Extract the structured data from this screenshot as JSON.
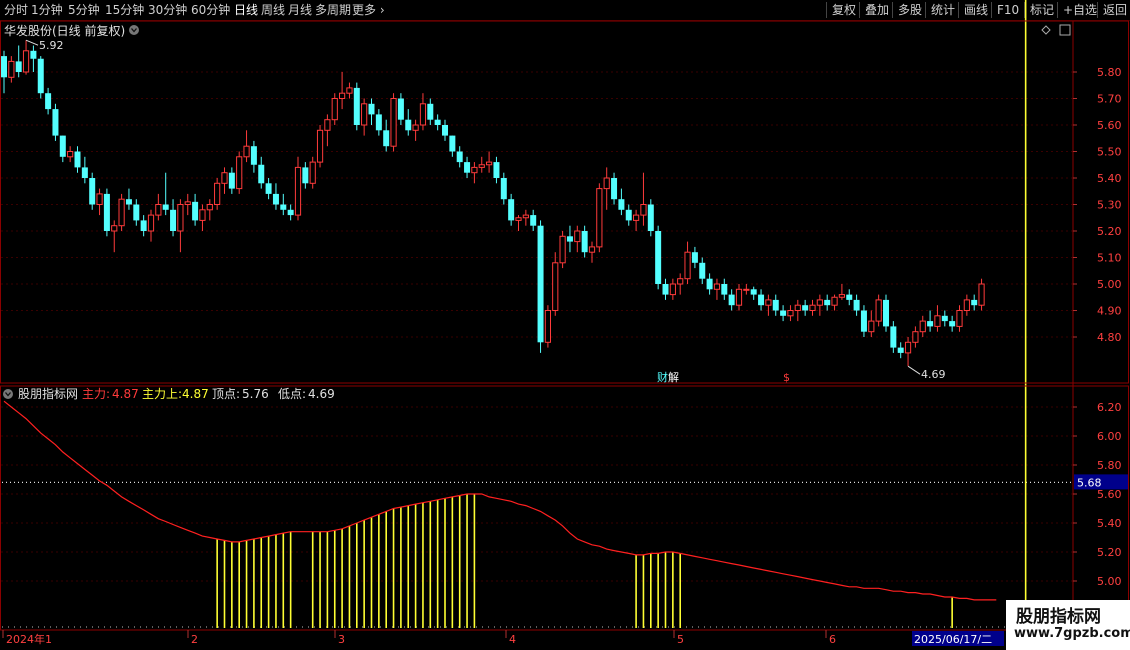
{
  "toolbar": {
    "left": [
      "分时",
      "1分钟",
      "5分钟",
      "15分钟",
      "30分钟",
      "60分钟",
      "日线",
      "周线",
      "月线",
      "多周期",
      "更多"
    ],
    "active": "日线",
    "right": [
      "复权",
      "叠加",
      "多股",
      "统计",
      "画线",
      "F10",
      "标记",
      "+自选",
      "返回"
    ]
  },
  "main_panel": {
    "title": "华发股份(日线 前复权)",
    "high_label": "5.92",
    "low_label": "4.69",
    "event_labels": [
      "财",
      "解",
      "$"
    ]
  },
  "indicator_panel": {
    "name": "股朋指标网",
    "params": [
      {
        "label": "主力:",
        "value": "4.87",
        "color": "#ff3b3b"
      },
      {
        "label": "主力上:",
        "value": "4.87",
        "color": "#ffff33"
      },
      {
        "label": "顶点:",
        "value": "5.76",
        "color": "#e0e0e0"
      },
      {
        "label": "低点:",
        "value": "4.69",
        "color": "#e0e0e0"
      }
    ],
    "dotted_value": "5.68"
  },
  "time_axis": {
    "labels": [
      "2024年1",
      "2",
      "3",
      "4",
      "5",
      "6"
    ],
    "current_date": "2025/06/17/二"
  },
  "watermark": {
    "line1": "股朋指标网",
    "line2": "www.7gpzb.com"
  },
  "chart_data": [
    {
      "type": "candlestick",
      "title": "华发股份(日线 前复权)",
      "ylim": [
        4.69,
        5.92
      ],
      "yticks": [
        4.8,
        4.9,
        5.0,
        5.1,
        5.2,
        5.3,
        5.4,
        5.5,
        5.6,
        5.7,
        5.8
      ],
      "up_color": "#ff3b3b",
      "down_color": "#54ffff",
      "ohlc": [
        [
          5.86,
          5.88,
          5.72,
          5.78
        ],
        [
          5.78,
          5.86,
          5.76,
          5.84
        ],
        [
          5.84,
          5.9,
          5.78,
          5.8
        ],
        [
          5.8,
          5.92,
          5.79,
          5.88
        ],
        [
          5.88,
          5.9,
          5.8,
          5.85
        ],
        [
          5.85,
          5.86,
          5.7,
          5.72
        ],
        [
          5.72,
          5.74,
          5.64,
          5.66
        ],
        [
          5.66,
          5.68,
          5.54,
          5.56
        ],
        [
          5.56,
          5.56,
          5.46,
          5.48
        ],
        [
          5.48,
          5.52,
          5.46,
          5.5
        ],
        [
          5.5,
          5.52,
          5.42,
          5.44
        ],
        [
          5.44,
          5.48,
          5.38,
          5.4
        ],
        [
          5.4,
          5.42,
          5.28,
          5.3
        ],
        [
          5.3,
          5.36,
          5.26,
          5.34
        ],
        [
          5.34,
          5.36,
          5.18,
          5.2
        ],
        [
          5.2,
          5.24,
          5.12,
          5.22
        ],
        [
          5.22,
          5.34,
          5.2,
          5.32
        ],
        [
          5.32,
          5.36,
          5.28,
          5.3
        ],
        [
          5.3,
          5.32,
          5.22,
          5.24
        ],
        [
          5.24,
          5.26,
          5.18,
          5.2
        ],
        [
          5.2,
          5.28,
          5.16,
          5.26
        ],
        [
          5.26,
          5.34,
          5.24,
          5.3
        ],
        [
          5.3,
          5.42,
          5.26,
          5.28
        ],
        [
          5.28,
          5.32,
          5.18,
          5.2
        ],
        [
          5.2,
          5.32,
          5.12,
          5.3
        ],
        [
          5.3,
          5.34,
          5.26,
          5.31
        ],
        [
          5.31,
          5.34,
          5.22,
          5.24
        ],
        [
          5.24,
          5.3,
          5.2,
          5.28
        ],
        [
          5.28,
          5.32,
          5.24,
          5.3
        ],
        [
          5.3,
          5.4,
          5.28,
          5.38
        ],
        [
          5.38,
          5.44,
          5.34,
          5.42
        ],
        [
          5.42,
          5.44,
          5.34,
          5.36
        ],
        [
          5.36,
          5.5,
          5.34,
          5.48
        ],
        [
          5.48,
          5.58,
          5.46,
          5.52
        ],
        [
          5.52,
          5.54,
          5.42,
          5.45
        ],
        [
          5.45,
          5.48,
          5.36,
          5.38
        ],
        [
          5.38,
          5.4,
          5.32,
          5.34
        ],
        [
          5.34,
          5.38,
          5.28,
          5.3
        ],
        [
          5.3,
          5.34,
          5.26,
          5.28
        ],
        [
          5.28,
          5.3,
          5.24,
          5.26
        ],
        [
          5.26,
          5.48,
          5.24,
          5.44
        ],
        [
          5.44,
          5.46,
          5.36,
          5.38
        ],
        [
          5.38,
          5.48,
          5.36,
          5.46
        ],
        [
          5.46,
          5.6,
          5.44,
          5.58
        ],
        [
          5.58,
          5.64,
          5.52,
          5.62
        ],
        [
          5.62,
          5.72,
          5.6,
          5.7
        ],
        [
          5.7,
          5.8,
          5.66,
          5.72
        ],
        [
          5.72,
          5.76,
          5.7,
          5.74
        ],
        [
          5.74,
          5.76,
          5.58,
          5.6
        ],
        [
          5.6,
          5.7,
          5.56,
          5.68
        ],
        [
          5.68,
          5.7,
          5.6,
          5.64
        ],
        [
          5.64,
          5.66,
          5.56,
          5.58
        ],
        [
          5.58,
          5.62,
          5.5,
          5.52
        ],
        [
          5.52,
          5.72,
          5.5,
          5.7
        ],
        [
          5.7,
          5.72,
          5.6,
          5.62
        ],
        [
          5.62,
          5.66,
          5.56,
          5.58
        ],
        [
          5.58,
          5.62,
          5.54,
          5.6
        ],
        [
          5.6,
          5.72,
          5.58,
          5.68
        ],
        [
          5.68,
          5.7,
          5.6,
          5.62
        ],
        [
          5.62,
          5.64,
          5.58,
          5.6
        ],
        [
          5.6,
          5.62,
          5.54,
          5.56
        ],
        [
          5.56,
          5.56,
          5.48,
          5.5
        ],
        [
          5.5,
          5.52,
          5.44,
          5.46
        ],
        [
          5.46,
          5.48,
          5.4,
          5.42
        ],
        [
          5.42,
          5.46,
          5.38,
          5.44
        ],
        [
          5.44,
          5.48,
          5.42,
          5.45
        ],
        [
          5.45,
          5.5,
          5.42,
          5.46
        ],
        [
          5.46,
          5.48,
          5.38,
          5.4
        ],
        [
          5.4,
          5.42,
          5.3,
          5.32
        ],
        [
          5.32,
          5.34,
          5.22,
          5.24
        ],
        [
          5.24,
          5.26,
          5.2,
          5.25
        ],
        [
          5.25,
          5.28,
          5.22,
          5.26
        ],
        [
          5.26,
          5.28,
          5.2,
          5.22
        ],
        [
          5.22,
          5.24,
          4.74,
          4.78
        ],
        [
          4.78,
          4.92,
          4.76,
          4.9
        ],
        [
          4.9,
          5.12,
          4.88,
          5.08
        ],
        [
          5.08,
          5.2,
          5.06,
          5.18
        ],
        [
          5.18,
          5.22,
          5.12,
          5.16
        ],
        [
          5.16,
          5.22,
          5.12,
          5.2
        ],
        [
          5.2,
          5.22,
          5.1,
          5.12
        ],
        [
          5.12,
          5.16,
          5.08,
          5.14
        ],
        [
          5.14,
          5.38,
          5.12,
          5.36
        ],
        [
          5.36,
          5.44,
          5.28,
          5.4
        ],
        [
          5.4,
          5.42,
          5.3,
          5.32
        ],
        [
          5.32,
          5.36,
          5.26,
          5.28
        ],
        [
          5.28,
          5.3,
          5.22,
          5.24
        ],
        [
          5.24,
          5.28,
          5.2,
          5.26
        ],
        [
          5.26,
          5.42,
          5.22,
          5.3
        ],
        [
          5.3,
          5.32,
          5.18,
          5.2
        ],
        [
          5.2,
          5.22,
          4.98,
          5.0
        ],
        [
          5.0,
          5.02,
          4.94,
          4.96
        ],
        [
          4.96,
          5.02,
          4.94,
          5.0
        ],
        [
          5.0,
          5.04,
          4.96,
          5.02
        ],
        [
          5.02,
          5.16,
          5.0,
          5.12
        ],
        [
          5.12,
          5.14,
          5.06,
          5.08
        ],
        [
          5.08,
          5.1,
          5.0,
          5.02
        ],
        [
          5.02,
          5.04,
          4.96,
          4.98
        ],
        [
          4.98,
          5.02,
          4.94,
          5.0
        ],
        [
          5.0,
          5.02,
          4.94,
          4.96
        ],
        [
          4.96,
          4.98,
          4.9,
          4.92
        ],
        [
          4.92,
          5.0,
          4.9,
          4.98
        ],
        [
          4.98,
          5.0,
          4.96,
          4.98
        ],
        [
          4.98,
          4.99,
          4.94,
          4.96
        ],
        [
          4.96,
          4.98,
          4.9,
          4.92
        ],
        [
          4.92,
          4.96,
          4.88,
          4.94
        ],
        [
          4.94,
          4.96,
          4.88,
          4.9
        ],
        [
          4.9,
          4.92,
          4.86,
          4.88
        ],
        [
          4.88,
          4.92,
          4.86,
          4.9
        ],
        [
          4.9,
          4.94,
          4.86,
          4.92
        ],
        [
          4.92,
          4.94,
          4.88,
          4.9
        ],
        [
          4.9,
          4.94,
          4.88,
          4.92
        ],
        [
          4.92,
          4.96,
          4.88,
          4.94
        ],
        [
          4.94,
          4.96,
          4.9,
          4.92
        ],
        [
          4.92,
          4.96,
          4.9,
          4.95
        ],
        [
          4.95,
          5.0,
          4.94,
          4.96
        ],
        [
          4.96,
          4.98,
          4.92,
          4.94
        ],
        [
          4.94,
          4.96,
          4.88,
          4.9
        ],
        [
          4.9,
          4.92,
          4.8,
          4.82
        ],
        [
          4.82,
          4.9,
          4.8,
          4.86
        ],
        [
          4.86,
          4.96,
          4.84,
          4.94
        ],
        [
          4.94,
          4.96,
          4.82,
          4.84
        ],
        [
          4.84,
          4.86,
          4.74,
          4.76
        ],
        [
          4.76,
          4.78,
          4.72,
          4.74
        ],
        [
          4.74,
          4.8,
          4.69,
          4.78
        ],
        [
          4.78,
          4.84,
          4.76,
          4.82
        ],
        [
          4.82,
          4.88,
          4.8,
          4.86
        ],
        [
          4.86,
          4.9,
          4.82,
          4.84
        ],
        [
          4.84,
          4.92,
          4.82,
          4.88
        ],
        [
          4.88,
          4.9,
          4.84,
          4.86
        ],
        [
          4.86,
          4.88,
          4.82,
          4.84
        ],
        [
          4.84,
          4.92,
          4.82,
          4.9
        ],
        [
          4.9,
          4.96,
          4.88,
          4.94
        ],
        [
          4.94,
          4.96,
          4.9,
          4.92
        ],
        [
          4.92,
          5.02,
          4.9,
          5.0
        ]
      ]
    },
    {
      "type": "line",
      "name": "股朋指标网",
      "ylim": [
        4.9,
        6.25
      ],
      "yticks": [
        5.0,
        5.2,
        5.4,
        5.6,
        5.8,
        6.0,
        6.2
      ],
      "dotted_line": 5.68,
      "line": [
        6.24,
        6.2,
        6.16,
        6.12,
        6.07,
        6.02,
        5.98,
        5.94,
        5.89,
        5.85,
        5.81,
        5.77,
        5.73,
        5.69,
        5.66,
        5.62,
        5.58,
        5.55,
        5.52,
        5.49,
        5.46,
        5.43,
        5.41,
        5.39,
        5.37,
        5.35,
        5.33,
        5.31,
        5.3,
        5.29,
        5.28,
        5.27,
        5.27,
        5.28,
        5.29,
        5.3,
        5.31,
        5.32,
        5.33,
        5.34,
        5.34,
        5.34,
        5.34,
        5.34,
        5.34,
        5.35,
        5.36,
        5.38,
        5.4,
        5.42,
        5.44,
        5.46,
        5.48,
        5.5,
        5.51,
        5.52,
        5.53,
        5.54,
        5.55,
        5.56,
        5.57,
        5.58,
        5.59,
        5.6,
        5.6,
        5.6,
        5.58,
        5.57,
        5.56,
        5.55,
        5.53,
        5.52,
        5.5,
        5.48,
        5.45,
        5.42,
        5.38,
        5.33,
        5.29,
        5.27,
        5.25,
        5.24,
        5.22,
        5.21,
        5.2,
        5.19,
        5.18,
        5.18,
        5.19,
        5.19,
        5.2,
        5.2,
        5.19,
        5.18,
        5.17,
        5.16,
        5.15,
        5.14,
        5.13,
        5.12,
        5.11,
        5.1,
        5.09,
        5.08,
        5.07,
        5.06,
        5.05,
        5.04,
        5.03,
        5.02,
        5.01,
        5.0,
        4.99,
        4.98,
        4.97,
        4.96,
        4.96,
        4.95,
        4.95,
        4.95,
        4.94,
        4.93,
        4.93,
        4.92,
        4.92,
        4.91,
        4.91,
        4.9,
        4.89,
        4.89,
        4.88,
        4.88,
        4.87,
        4.87,
        4.87,
        4.87
      ],
      "bar_ranges": [
        [
          29,
          39
        ],
        [
          42,
          64
        ],
        [
          86,
          92
        ],
        [
          129,
          129
        ],
        [
          139,
          139
        ]
      ]
    }
  ]
}
